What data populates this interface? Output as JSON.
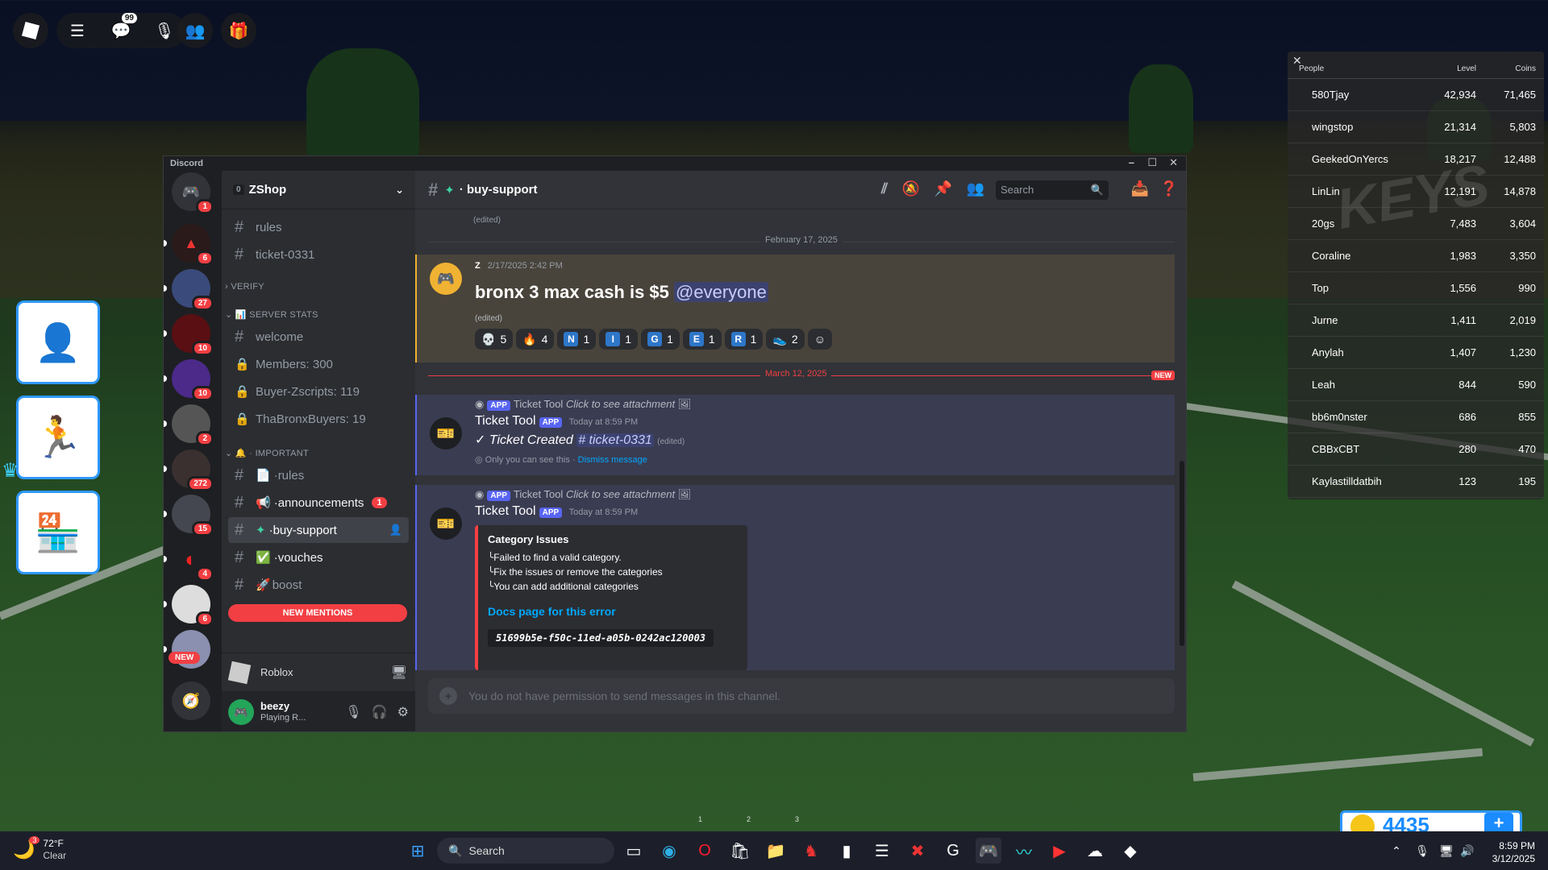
{
  "roblox": {
    "chat_badge": "99",
    "coins": "4435",
    "server_pages": [
      "1",
      "2",
      "3"
    ]
  },
  "leaderboard": {
    "headers": {
      "people": "People",
      "level": "Level",
      "coins": "Coins"
    },
    "rows": [
      {
        "name": "580Tjay",
        "level": "42,934",
        "coins": "71,465"
      },
      {
        "name": "wingstop",
        "level": "21,314",
        "coins": "5,803"
      },
      {
        "name": "GeekedOnYercs",
        "level": "18,217",
        "coins": "12,488"
      },
      {
        "name": "LinLin",
        "level": "12,191",
        "coins": "14,878"
      },
      {
        "name": "20gs",
        "level": "7,483",
        "coins": "3,604"
      },
      {
        "name": "Coraline",
        "level": "1,983",
        "coins": "3,350"
      },
      {
        "name": "Top",
        "level": "1,556",
        "coins": "990"
      },
      {
        "name": "Jurne",
        "level": "1,411",
        "coins": "2,019"
      },
      {
        "name": "Anylah",
        "level": "1,407",
        "coins": "1,230"
      },
      {
        "name": "Leah",
        "level": "844",
        "coins": "590"
      },
      {
        "name": "bb6m0nster",
        "level": "686",
        "coins": "855"
      },
      {
        "name": "CBBxCBT",
        "level": "280",
        "coins": "470"
      },
      {
        "name": "Kaylastilldatbih",
        "level": "123",
        "coins": "195"
      }
    ],
    "watermark": "KEYS"
  },
  "discord": {
    "window_title": "Discord",
    "server": {
      "name": "ZShop",
      "boost_count": "0"
    },
    "guild_badges": [
      "1",
      "6",
      "27",
      "10",
      "10",
      "2",
      "272",
      "15",
      "4",
      "6"
    ],
    "guild_new": "NEW",
    "channels": {
      "top": [
        "rules",
        "ticket-0331"
      ],
      "cat_verify": "VERIFY",
      "cat_stats": "SERVER STATS",
      "stats": [
        "welcome",
        "Members: 300",
        "Buyer-Zscripts: 119",
        "ThaBronxBuyers: 19"
      ],
      "cat_important": "IMPORTANT",
      "important": [
        "rules",
        "announcements",
        "buy-support",
        "vouches",
        "boost"
      ],
      "announcements_badge": "1",
      "new_mentions": "NEW MENTIONS"
    },
    "user": {
      "name": "beezy",
      "status": "Playing R...",
      "activity": "Roblox"
    },
    "header": {
      "channel": "buy-support",
      "search_placeholder": "Search"
    },
    "edited": "(edited)",
    "date1": "February 17, 2025",
    "msg1": {
      "author": "Z",
      "time": "2/17/2025 2:42 PM",
      "text": "bronx 3 max cash is $5",
      "mention": "@everyone",
      "reactions": [
        {
          "emoji": "💀",
          "count": "5"
        },
        {
          "emoji": "🔥",
          "count": "4"
        },
        {
          "emoji": "N",
          "count": "1"
        },
        {
          "emoji": "I",
          "count": "1"
        },
        {
          "emoji": "G",
          "count": "1"
        },
        {
          "emoji": "E",
          "count": "1"
        },
        {
          "emoji": "R",
          "count": "1"
        },
        {
          "emoji": "👟",
          "count": "2"
        }
      ]
    },
    "date2": "March 12, 2025",
    "new_label": "NEW",
    "msg2": {
      "reply_app": "APP",
      "reply_author": "Ticket Tool",
      "reply_text": "Click to see attachment",
      "author": "Ticket Tool",
      "app": "APP",
      "time": "Today at 8:59 PM",
      "text": "✓ Ticket Created",
      "channel": "ticket-0331",
      "edited": "(edited)",
      "ephemeral": "Only you can see this",
      "dismiss": "Dismiss message"
    },
    "msg3": {
      "reply_app": "APP",
      "reply_author": "Ticket Tool",
      "reply_text": "Click to see attachment",
      "author": "Ticket Tool",
      "app": "APP",
      "time": "Today at 8:59 PM",
      "embed_title": "Category Issues",
      "embed_lines": [
        "╰Failed to find a valid category.",
        "╰Fix the issues or remove the categories",
        "╰You can add additional categories"
      ],
      "embed_link": "Docs page for this error",
      "embed_code": "51699b5e-f50c-11ed-a05b-0242ac120003"
    },
    "input_placeholder": "You do not have permission to send messages in this channel."
  },
  "taskbar": {
    "weather_temp": "72°F",
    "weather_desc": "Clear",
    "weather_badge": "3",
    "search": "Search",
    "time": "8:59 PM",
    "date": "3/12/2025"
  }
}
